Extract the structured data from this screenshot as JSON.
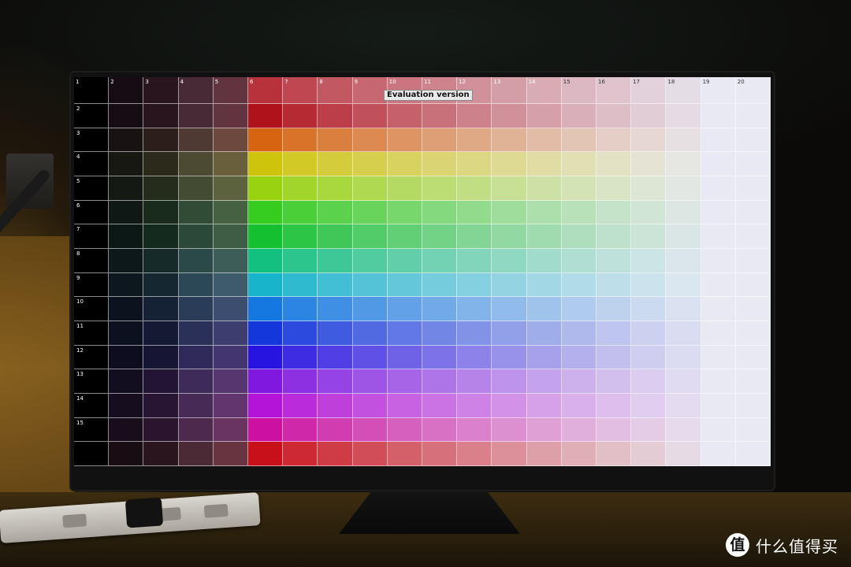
{
  "screen": {
    "column_numbers": [
      "1",
      "2",
      "3",
      "4",
      "5",
      "6",
      "7",
      "8",
      "9",
      "10",
      "11",
      "12",
      "13",
      "14",
      "15",
      "16",
      "17",
      "18",
      "19",
      "20"
    ],
    "row_numbers": [
      "",
      "2",
      "3",
      "4",
      "5",
      "6",
      "7",
      "8",
      "9",
      "10",
      "11",
      "12",
      "13",
      "14",
      "15"
    ],
    "evaluation_label": "Evaluation version",
    "hue_rows": [
      "#b0121c",
      "#d76410",
      "#cfc40c",
      "#98d210",
      "#36cc20",
      "#14c030",
      "#14c080",
      "#18b4cc",
      "#1478e0",
      "#1437dc",
      "#2814e0",
      "#8018e0",
      "#b414d8",
      "#cc10a0",
      "#c8101a"
    ],
    "dark_columns": [
      "#000000",
      "#0c0d13",
      "#15151d",
      "#302f3b",
      "#4a3f4c"
    ],
    "screen_white": "#e8e9f2"
  },
  "watermark": {
    "icon_glyph": "值",
    "text": "什么值得买"
  }
}
